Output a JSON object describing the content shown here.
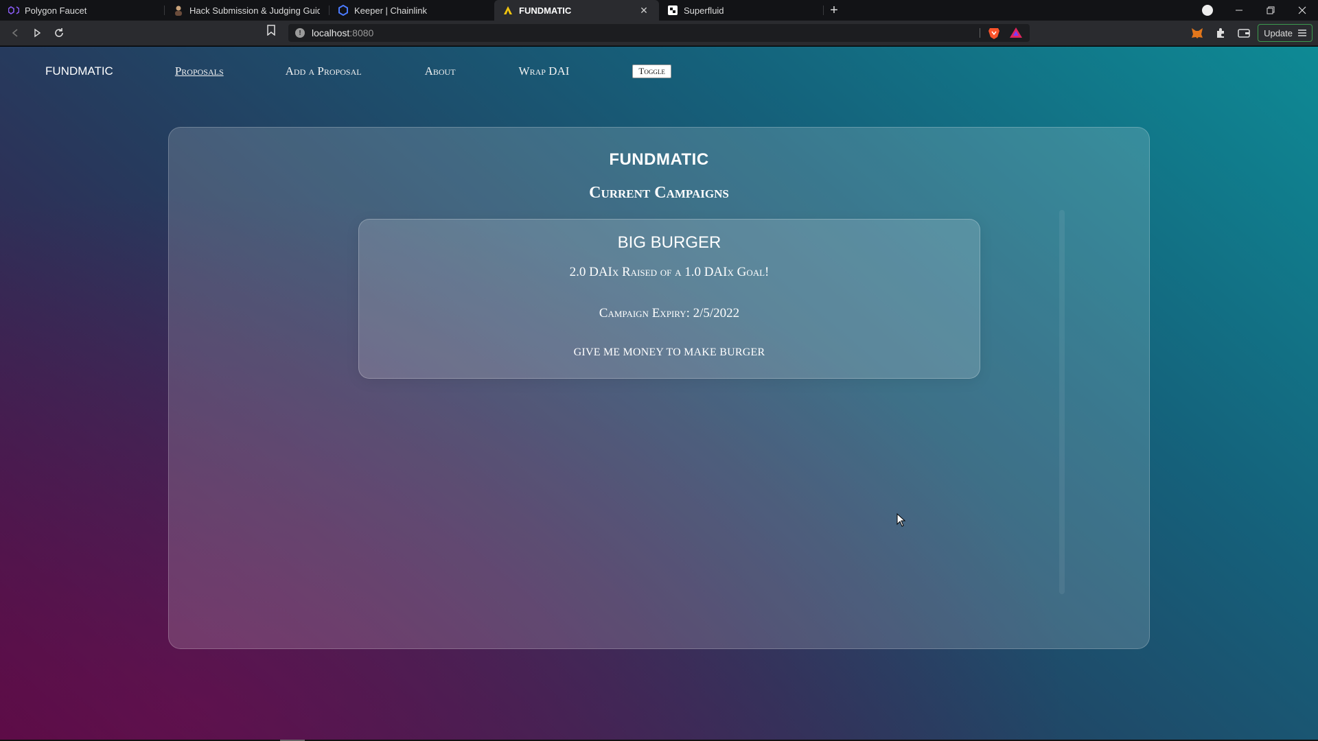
{
  "browser": {
    "tabs": [
      {
        "label": "Polygon Faucet",
        "icon": "polygon-icon",
        "active": false
      },
      {
        "label": "Hack Submission & Judging Guide",
        "icon": "person-icon",
        "active": false
      },
      {
        "label": "Keeper | Chainlink",
        "icon": "chainlink-icon",
        "active": false
      },
      {
        "label": "FUNDMATIC",
        "icon": "fundmatic-icon",
        "active": true
      },
      {
        "label": "Superfluid",
        "icon": "superfluid-icon",
        "active": false
      }
    ],
    "close_tab": "✕",
    "new_tab": "+",
    "url_host": "localhost",
    "url_port": ":8080",
    "update_label": "Update",
    "colors": {
      "tabstrip": "#121316",
      "toolbar": "#2a2b2f",
      "update_border": "#3d9c4f"
    }
  },
  "nav": {
    "brand": "FUNDMATIC",
    "links": [
      "Proposals",
      "Add a Proposal",
      "About",
      "Wrap DAI"
    ],
    "current": "Proposals",
    "toggle": "Toggle"
  },
  "main": {
    "title": "FUNDMATIC",
    "subtitle": "Current Campaigns",
    "campaigns": [
      {
        "name": "BIG BURGER",
        "raised": "2.0 DAIx Raised of a 1.0 DAIx Goal!",
        "expiry": "Campaign Expiry: 2/5/2022",
        "description": "GIVE ME MONEY TO MAKE BURGER"
      }
    ]
  },
  "theme": {
    "gradient_start": "#0e8a95",
    "gradient_end": "#4a0d40",
    "text": "#ffffff"
  }
}
